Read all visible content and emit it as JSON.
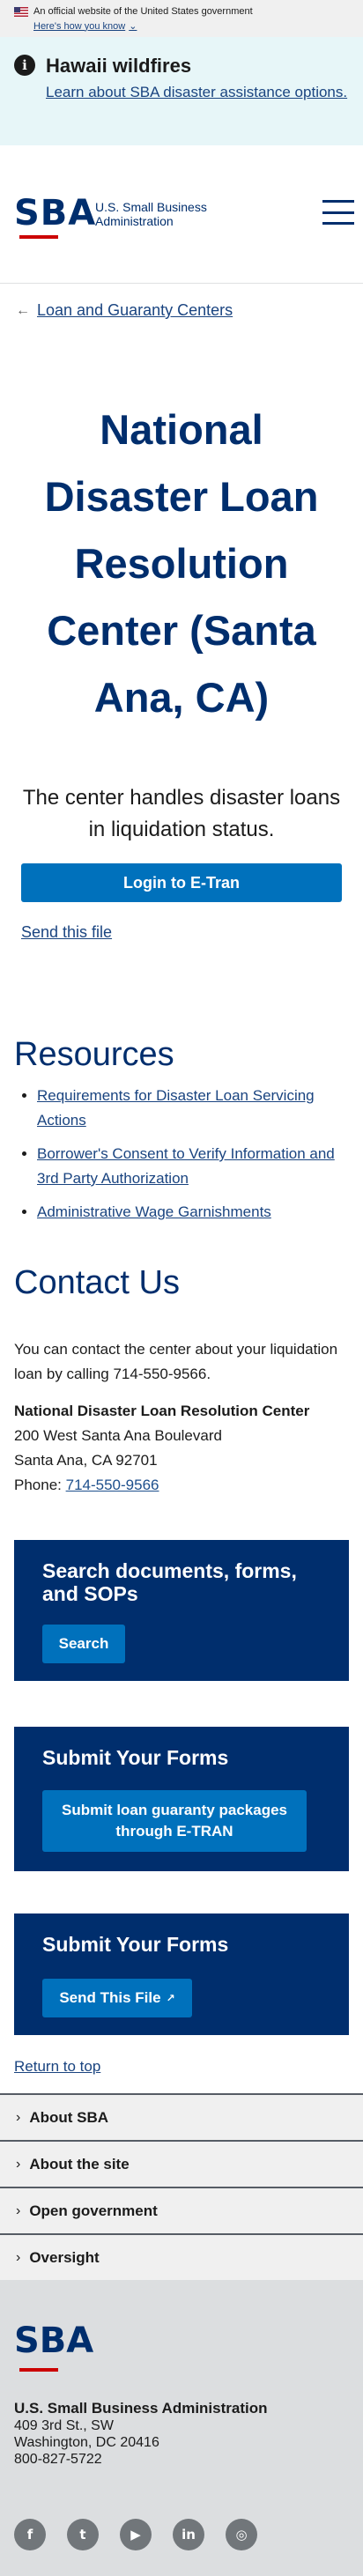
{
  "gov_banner": {
    "text": "An official website of the United States government",
    "link": "Here's how you know"
  },
  "alert": {
    "title": "Hawaii wildfires",
    "link": "Learn about SBA disaster assistance options."
  },
  "header": {
    "logo_text": "SBA",
    "logo_subtitle_line1": "U.S. Small Business",
    "logo_subtitle_line2": "Administration"
  },
  "breadcrumb": {
    "label": "Loan and Guaranty Centers"
  },
  "hero": {
    "title": "National Disaster Loan Resolution Center (Santa Ana, CA)",
    "lead": "The center handles disaster loans in liquidation status.",
    "primary_button": "Login to E-Tran",
    "secondary_link": "Send this file"
  },
  "resources": {
    "heading": "Resources",
    "items": [
      "Requirements for Disaster Loan Servicing Actions",
      "Borrower's Consent to Verify Information and 3rd Party Authorization",
      "Administrative Wage Garnishments"
    ]
  },
  "contact": {
    "heading": "Contact Us",
    "intro": "You can contact the center about your liquidation loan by calling 714-550-9566.",
    "name": "National Disaster Loan Resolution Center",
    "street": "200 West Santa Ana Boulevard",
    "city": "Santa Ana, CA 92701",
    "phone_label": "Phone: ",
    "phone": "714-550-9566"
  },
  "cards": [
    {
      "title": "Search documents, forms, and SOPs",
      "button": "Search"
    },
    {
      "title": "Submit Your Forms",
      "button": "Submit loan guaranty packages through E-TRAN"
    },
    {
      "title": "Submit Your Forms",
      "button": "Send This File"
    }
  ],
  "return_top": "Return to top",
  "footer_nav": [
    "About SBA",
    "About the site",
    "Open government",
    "Oversight"
  ],
  "footer": {
    "org": "U.S. Small Business Administration",
    "addr1": "409 3rd St., SW",
    "addr2": "Washington, DC 20416",
    "phone": "800-827-5722",
    "social": [
      "facebook-icon",
      "twitter-icon",
      "youtube-icon",
      "linkedin-icon",
      "instagram-icon"
    ]
  },
  "colors": {
    "navy": "#002e6d",
    "primary": "#0071bc",
    "link": "#1a4480",
    "alert_bg": "#e7f6f8",
    "footer_bg": "#dcdee0"
  }
}
